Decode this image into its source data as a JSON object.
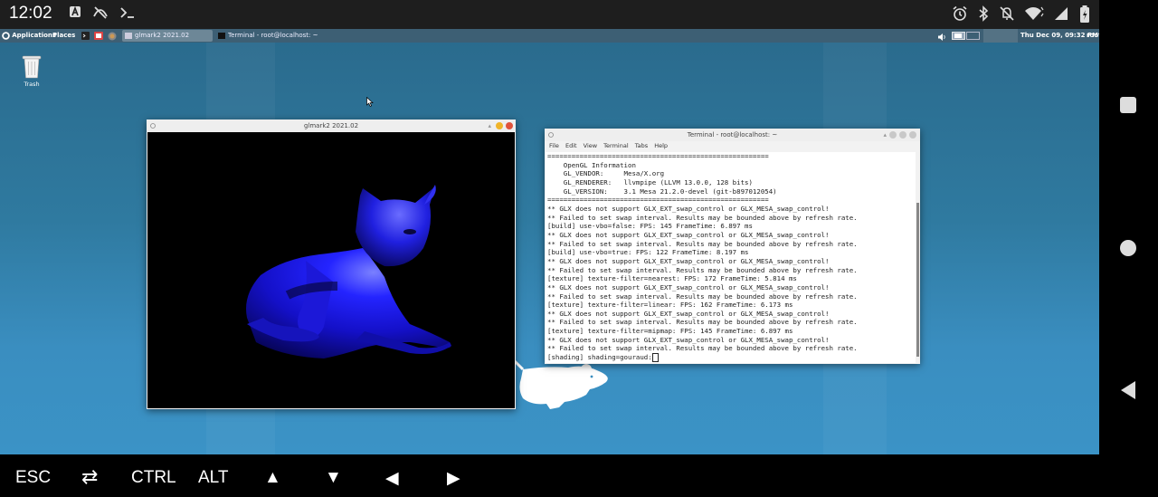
{
  "status_bar": {
    "time": "12:02",
    "icons": [
      "a-icon",
      "network-off-icon",
      "terminal-prompt-icon",
      "alarm-icon",
      "bluetooth-icon",
      "mute-icon",
      "wifi-icon",
      "signal-icon",
      "battery-icon"
    ]
  },
  "panel": {
    "applications": "Applications",
    "places": "Places",
    "tasks": [
      {
        "label": "glmark2 2021.02",
        "active": true
      },
      {
        "label": "Terminal - root@localhost: ~",
        "active": false
      }
    ],
    "clock": "Thu Dec 09, 09:32 PM",
    "user": "root"
  },
  "desktop": {
    "trash_label": "Trash"
  },
  "glmark_window": {
    "title": "glmark2 2021.02"
  },
  "terminal_window": {
    "title": "Terminal - root@localhost: ~",
    "menu": [
      "File",
      "Edit",
      "View",
      "Terminal",
      "Tabs",
      "Help"
    ],
    "lines": [
      "=======================================================",
      "    OpenGL Information",
      "    GL_VENDOR:     Mesa/X.org",
      "    GL_RENDERER:   llvmpipe (LLVM 13.0.0, 128 bits)",
      "    GL_VERSION:    3.1 Mesa 21.2.0-devel (git-b897012054)",
      "=======================================================",
      "** GLX does not support GLX_EXT_swap_control or GLX_MESA_swap_control!",
      "** Failed to set swap interval. Results may be bounded above by refresh rate.",
      "[build] use-vbo=false: FPS: 145 FrameTime: 6.897 ms",
      "** GLX does not support GLX_EXT_swap_control or GLX_MESA_swap_control!",
      "** Failed to set swap interval. Results may be bounded above by refresh rate.",
      "[build] use-vbo=true: FPS: 122 FrameTime: 8.197 ms",
      "** GLX does not support GLX_EXT_swap_control or GLX_MESA_swap_control!",
      "** Failed to set swap interval. Results may be bounded above by refresh rate.",
      "[texture] texture-filter=nearest: FPS: 172 FrameTime: 5.814 ms",
      "** GLX does not support GLX_EXT_swap_control or GLX_MESA_swap_control!",
      "** Failed to set swap interval. Results may be bounded above by refresh rate.",
      "[texture] texture-filter=linear: FPS: 162 FrameTime: 6.173 ms",
      "** GLX does not support GLX_EXT_swap_control or GLX_MESA_swap_control!",
      "** Failed to set swap interval. Results may be bounded above by refresh rate.",
      "[texture] texture-filter=mipmap: FPS: 145 FrameTime: 6.897 ms",
      "** GLX does not support GLX_EXT_swap_control or GLX_MESA_swap_control!",
      "** Failed to set swap interval. Results may be bounded above by refresh rate."
    ],
    "prompt": "[shading] shading=gouraud:"
  },
  "key_bar": {
    "esc": "ESC",
    "tab": "⇄",
    "ctrl": "CTRL",
    "alt": "ALT",
    "up": "▲",
    "down": "▼",
    "left": "◀",
    "right": "▶"
  },
  "colors": {
    "desktop_top": "#2a6a8c",
    "desktop_bottom": "#3b93c6",
    "panel": "#3d5f74",
    "cat_blue": "#1a14d8",
    "close_red": "#e0533c",
    "minimize_yellow": "#f0b429"
  }
}
